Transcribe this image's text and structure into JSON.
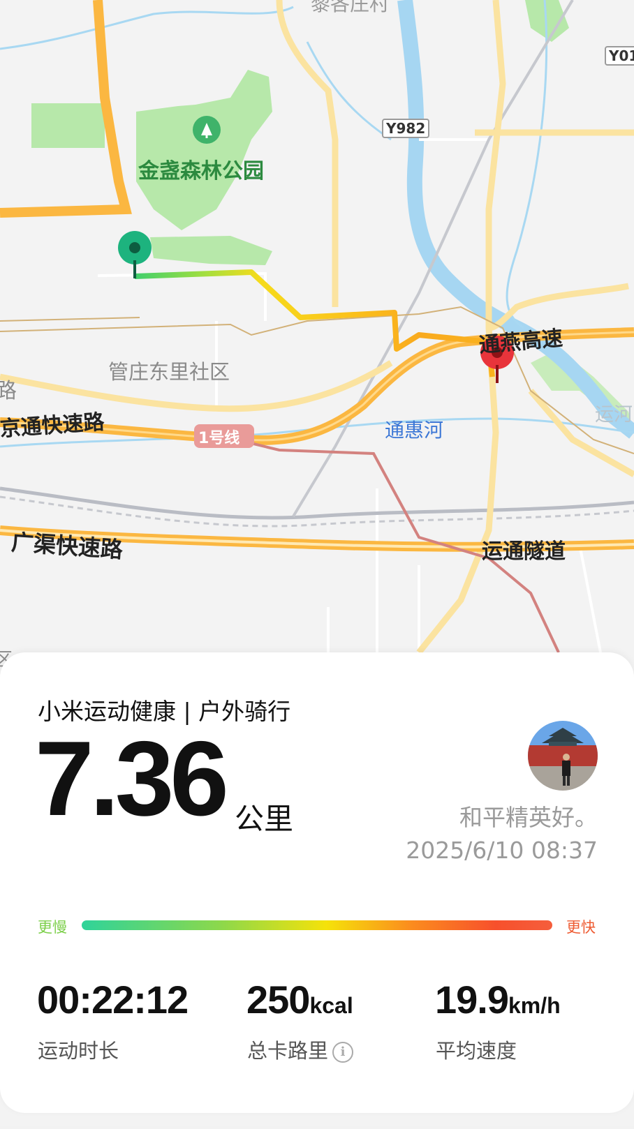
{
  "map": {
    "labels": {
      "park": "金盏森林公园",
      "community": "管庄东里社区",
      "expressway_jingtong": "京通快速路",
      "line1": "1号线",
      "tonghui_river": "通惠河",
      "tongyan_expressway": "通燕高速",
      "guangqu_expressway": "广渠快速路",
      "yuntong_tunnel": "运通隧道",
      "canal": "运河",
      "road_y982": "Y982",
      "road_y01": "Y01",
      "partial_top": "黎各庄村",
      "partial_left": "路",
      "partial_bottom_left": "区"
    },
    "start_marker_color": "#1db37e",
    "end_marker_color": "#e8343b"
  },
  "card": {
    "app_title": "小米运动健康 | 户外骑行",
    "distance_value": "7.36",
    "distance_unit": "公里",
    "username": "和平精英好。",
    "datetime": "2025/6/10 08:37",
    "legend_slower": "更慢",
    "legend_faster": "更快",
    "stats": [
      {
        "value": "00:22:12",
        "unit": "",
        "label": "运动时长"
      },
      {
        "value": "250",
        "unit": "kcal",
        "label": "总卡路里"
      },
      {
        "value": "19.9",
        "unit": "km/h",
        "label": "平均速度"
      }
    ],
    "info_icon": "i"
  }
}
